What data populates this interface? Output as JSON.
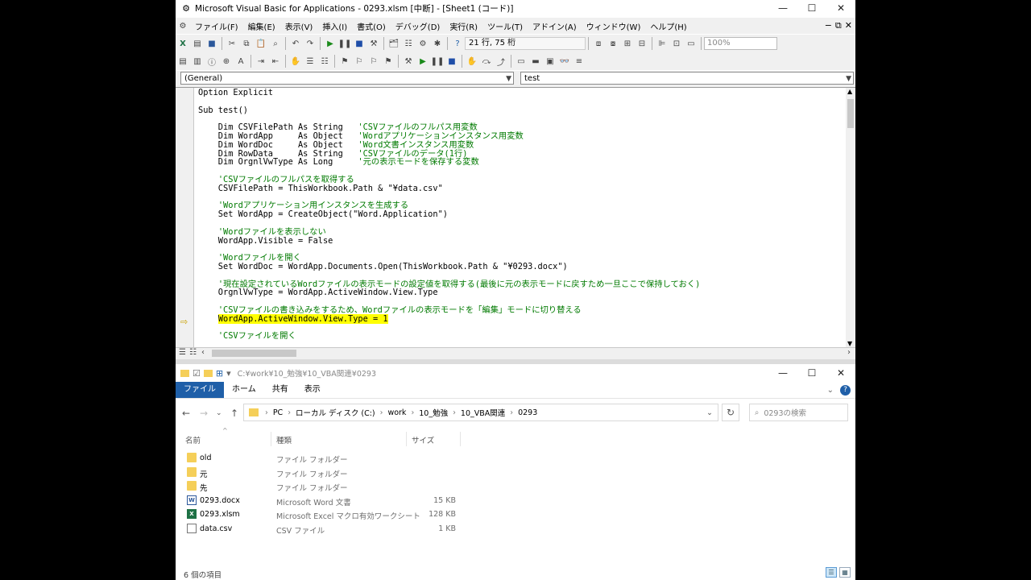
{
  "vba": {
    "title": "Microsoft Visual Basic for Applications - 0293.xlsm [中断] - [Sheet1 (コード)]",
    "menu": [
      "ファイル(F)",
      "編集(E)",
      "表示(V)",
      "挿入(I)",
      "書式(O)",
      "デバッグ(D)",
      "実行(R)",
      "ツール(T)",
      "アドイン(A)",
      "ウィンドウ(W)",
      "ヘルプ(H)"
    ],
    "cursor_position": "21 行, 75 桁",
    "zoom": "100%",
    "object_combo": "(General)",
    "proc_combo": "test",
    "code_lines": [
      {
        "code": "Option Explicit",
        "comment": ""
      },
      {
        "code": "",
        "comment": ""
      },
      {
        "code": "Sub test()",
        "comment": ""
      },
      {
        "code": "",
        "comment": ""
      },
      {
        "code": "    Dim CSVFilePath As String   ",
        "comment": "'CSVファイルのフルパス用変数"
      },
      {
        "code": "    Dim WordApp     As Object   ",
        "comment": "'Wordアプリケーションインスタンス用変数"
      },
      {
        "code": "    Dim WordDoc     As Object   ",
        "comment": "'Word文書インスタンス用変数"
      },
      {
        "code": "    Dim RowData     As String   ",
        "comment": "'CSVファイルのデータ(1行)"
      },
      {
        "code": "    Dim OrgnlVwType As Long     ",
        "comment": "'元の表示モードを保存する変数"
      },
      {
        "code": "",
        "comment": ""
      },
      {
        "code": "    ",
        "comment": "'CSVファイルのフルパスを取得する"
      },
      {
        "code": "    CSVFilePath = ThisWorkbook.Path & \"¥data.csv\"",
        "comment": ""
      },
      {
        "code": "",
        "comment": ""
      },
      {
        "code": "    ",
        "comment": "'Wordアプリケーション用インスタンスを生成する"
      },
      {
        "code": "    Set WordApp = CreateObject(\"Word.Application\")",
        "comment": ""
      },
      {
        "code": "",
        "comment": ""
      },
      {
        "code": "    ",
        "comment": "'Wordファイルを表示しない"
      },
      {
        "code": "    WordApp.Visible = False",
        "comment": ""
      },
      {
        "code": "",
        "comment": ""
      },
      {
        "code": "    ",
        "comment": "'Wordファイルを開く"
      },
      {
        "code": "    Set WordDoc = WordApp.Documents.Open(ThisWorkbook.Path & \"¥0293.docx\")",
        "comment": ""
      },
      {
        "code": "",
        "comment": ""
      },
      {
        "code": "    ",
        "comment": "'現在設定されているWordファイルの表示モードの設定値を取得する(最後に元の表示モードに戻すため一旦ここで保持しておく)"
      },
      {
        "code": "    OrgnlVwType = WordApp.ActiveWindow.View.Type",
        "comment": ""
      },
      {
        "code": "",
        "comment": ""
      },
      {
        "code": "    ",
        "comment": "'CSVファイルの書き込みをするため、Wordファイルの表示モードを「編集」モードに切り替える"
      },
      {
        "code": "    ",
        "comment": ""
      },
      {
        "code": "",
        "comment": ""
      },
      {
        "code": "    ",
        "comment": "'CSVファイルを開く"
      }
    ],
    "highlight_line": "WordApp.ActiveWindow.View.Type = 1"
  },
  "explorer": {
    "title_path": "C:¥work¥10_勉強¥10_VBA関連¥0293",
    "tabs": [
      "ファイル",
      "ホーム",
      "共有",
      "表示"
    ],
    "breadcrumb": [
      "PC",
      "ローカル ディスク (C:)",
      "work",
      "10_勉強",
      "10_VBA関連",
      "0293"
    ],
    "search_placeholder": "0293の検索",
    "columns": [
      "名前",
      "種類",
      "サイズ"
    ],
    "files": [
      {
        "name": "old",
        "type": "ファイル フォルダー",
        "size": "",
        "icon": "folder-icon"
      },
      {
        "name": "元",
        "type": "ファイル フォルダー",
        "size": "",
        "icon": "folder-icon"
      },
      {
        "name": "先",
        "type": "ファイル フォルダー",
        "size": "",
        "icon": "folder-icon"
      },
      {
        "name": "0293.docx",
        "type": "Microsoft Word 文書",
        "size": "15 KB",
        "icon": "word-file-icon"
      },
      {
        "name": "0293.xlsm",
        "type": "Microsoft Excel マクロ有効ワークシート",
        "size": "128 KB",
        "icon": "excel-file-icon"
      },
      {
        "name": "data.csv",
        "type": "CSV ファイル",
        "size": "1 KB",
        "icon": "csv-file-icon"
      }
    ],
    "item_count": "6 個の項目"
  }
}
